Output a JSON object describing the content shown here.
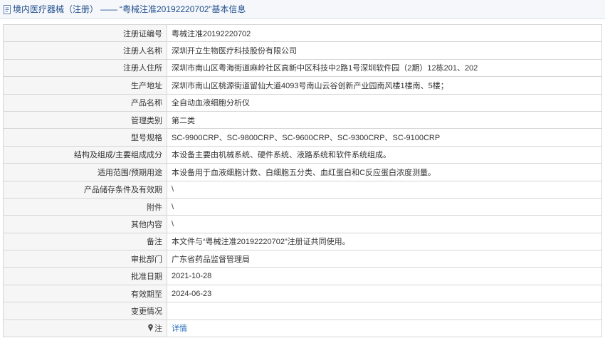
{
  "header": {
    "category": "境内医疗器械（注册）",
    "separator": "——",
    "subject": "“粤械注准20192220702”基本信息",
    "icon": "document-icon"
  },
  "rows": [
    {
      "label": "注册证编号",
      "value": "粤械注准20192220702"
    },
    {
      "label": "注册人名称",
      "value": "深圳开立生物医疗科技股份有限公司"
    },
    {
      "label": "注册人住所",
      "value": "深圳市南山区粤海街道麻岭社区高新中区科技中2路1号深圳软件园（2期）12栋201、202"
    },
    {
      "label": "生产地址",
      "value": "深圳市南山区桃源街道留仙大道4093号南山云谷创新产业园南风楼1楼南、5楼；"
    },
    {
      "label": "产品名称",
      "value": "全自动血液细胞分析仪"
    },
    {
      "label": "管理类别",
      "value": "第二类"
    },
    {
      "label": "型号规格",
      "value": "SC-9900CRP、SC-9800CRP、SC-9600CRP、SC-9300CRP、SC-9100CRP"
    },
    {
      "label": "结构及组成/主要组成成分",
      "value": "本设备主要由机械系统、硬件系统、液路系统和软件系统组成。"
    },
    {
      "label": "适用范围/预期用途",
      "value": "本设备用于血液细胞计数、白细胞五分类、血红蛋白和C反应蛋白浓度测量。"
    },
    {
      "label": "产品储存条件及有效期",
      "value": "\\"
    },
    {
      "label": "附件",
      "value": "\\"
    },
    {
      "label": "其他内容",
      "value": "\\"
    },
    {
      "label": "备注",
      "value": "本文件与“粤械注准20192220702”注册证共同使用。"
    },
    {
      "label": "审批部门",
      "value": "广东省药品监督管理局"
    },
    {
      "label": "批准日期",
      "value": "2021-10-28"
    },
    {
      "label": "有效期至",
      "value": "2024-06-23"
    },
    {
      "label": "变更情况",
      "value": ""
    }
  ],
  "note_row": {
    "label": "注",
    "icon": "pin-icon",
    "link": "详情"
  },
  "colors": {
    "title_text": "#1f4e8c",
    "link": "#2a6ebb",
    "border": "#d6d6d6",
    "label_bg": "#f6f6f6"
  }
}
